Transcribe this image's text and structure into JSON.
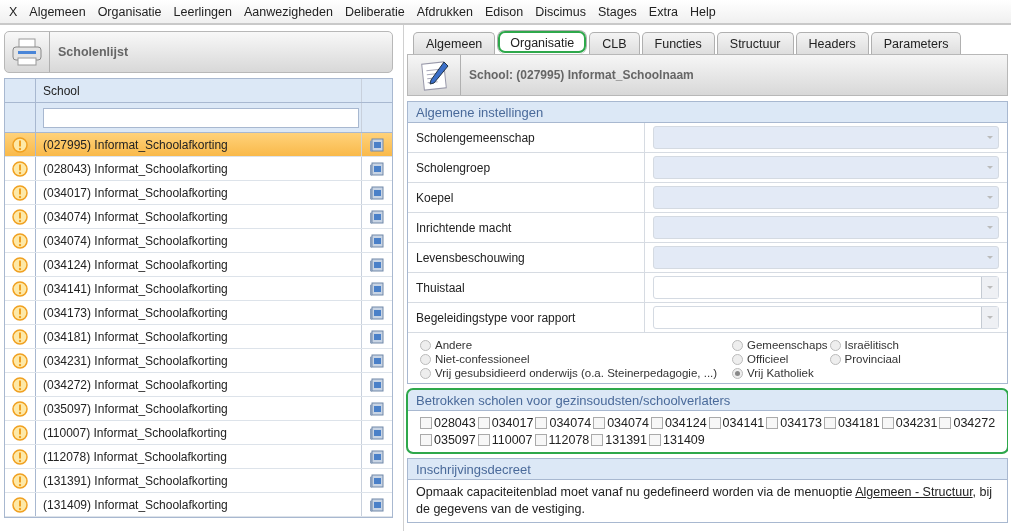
{
  "menu": [
    "X",
    "Algemeen",
    "Organisatie",
    "Leerlingen",
    "Aanwezigheden",
    "Deliberatie",
    "Afdrukken",
    "Edison",
    "Discimus",
    "Stages",
    "Extra",
    "Help"
  ],
  "school_list": {
    "title": "Scholenlijst",
    "column": "School",
    "rows": [
      {
        "name": "(027995) Informat_Schoolafkorting",
        "selected": true
      },
      {
        "name": "(028043) Informat_Schoolafkorting",
        "selected": false
      },
      {
        "name": "(034017) Informat_Schoolafkorting",
        "selected": false
      },
      {
        "name": "(034074) Informat_Schoolafkorting",
        "selected": false
      },
      {
        "name": "(034074) Informat_Schoolafkorting",
        "selected": false
      },
      {
        "name": "(034124) Informat_Schoolafkorting",
        "selected": false
      },
      {
        "name": "(034141) Informat_Schoolafkorting",
        "selected": false
      },
      {
        "name": "(034173) Informat_Schoolafkorting",
        "selected": false
      },
      {
        "name": "(034181) Informat_Schoolafkorting",
        "selected": false
      },
      {
        "name": "(034231) Informat_Schoolafkorting",
        "selected": false
      },
      {
        "name": "(034272) Informat_Schoolafkorting",
        "selected": false
      },
      {
        "name": "(035097) Informat_Schoolafkorting",
        "selected": false
      },
      {
        "name": "(110007) Informat_Schoolafkorting",
        "selected": false
      },
      {
        "name": "(112078) Informat_Schoolafkorting",
        "selected": false
      },
      {
        "name": "(131391) Informat_Schoolafkorting",
        "selected": false
      },
      {
        "name": "(131409) Informat_Schoolafkorting",
        "selected": false
      }
    ]
  },
  "tabs": [
    {
      "label": "Algemeen",
      "selected": false,
      "highlighted": false
    },
    {
      "label": "Organisatie",
      "selected": true,
      "highlighted": true
    },
    {
      "label": "CLB",
      "selected": false,
      "highlighted": false
    },
    {
      "label": "Functies",
      "selected": false,
      "highlighted": false
    },
    {
      "label": "Structuur",
      "selected": false,
      "highlighted": false
    },
    {
      "label": "Headers",
      "selected": false,
      "highlighted": false
    },
    {
      "label": "Parameters",
      "selected": false,
      "highlighted": false
    }
  ],
  "detail_title": "School: (027995) Informat_Schoolnaam",
  "general": {
    "title": "Algemene instellingen",
    "fields": [
      {
        "label": "Scholengemeenschap",
        "disabled": true
      },
      {
        "label": "Scholengroep",
        "disabled": true
      },
      {
        "label": "Koepel",
        "disabled": true
      },
      {
        "label": "Inrichtende macht",
        "disabled": true
      },
      {
        "label": "Levensbeschouwing",
        "disabled": true
      },
      {
        "label": "Thuistaal",
        "disabled": false
      },
      {
        "label": "Begeleidingstype voor rapport",
        "disabled": false
      }
    ],
    "radios": [
      {
        "label": "Andere",
        "selected": false
      },
      {
        "label": "Gemeenschaps",
        "selected": false
      },
      {
        "label": "Israëlitisch",
        "selected": false
      },
      {
        "label": "Niet-confessioneel",
        "selected": false
      },
      {
        "label": "Officieel",
        "selected": false
      },
      {
        "label": "Provinciaal",
        "selected": false
      },
      {
        "label": "Vrij gesubsidieerd onderwijs (o.a. Steinerpedagogie, ...)",
        "selected": false
      },
      {
        "label": "Vrij Katholiek",
        "selected": true
      }
    ]
  },
  "schools_section": {
    "title": "Betrokken scholen voor gezinsoudsten/schoolverlaters",
    "highlighted": true,
    "checkboxes": [
      {
        "label": "028043",
        "checked": false
      },
      {
        "label": "034017",
        "checked": false
      },
      {
        "label": "034074",
        "checked": false
      },
      {
        "label": "034074",
        "checked": false
      },
      {
        "label": "034124",
        "checked": false
      },
      {
        "label": "034141",
        "checked": false
      },
      {
        "label": "034173",
        "checked": false
      },
      {
        "label": "034181",
        "checked": false
      },
      {
        "label": "034231",
        "checked": false
      },
      {
        "label": "034272",
        "checked": false
      },
      {
        "label": "035097",
        "checked": false
      },
      {
        "label": "110007",
        "checked": false
      },
      {
        "label": "112078",
        "checked": false
      },
      {
        "label": "131391",
        "checked": false
      },
      {
        "label": "131409",
        "checked": false
      }
    ]
  },
  "decree": {
    "title": "Inschrijvingsdecreet",
    "text_before": "Opmaak capaciteitenblad moet vanaf nu gedefineerd worden via de menuoptie ",
    "link": "Algemeen - Structuur",
    "text_after": ", bij de gegevens van de vestiging."
  }
}
